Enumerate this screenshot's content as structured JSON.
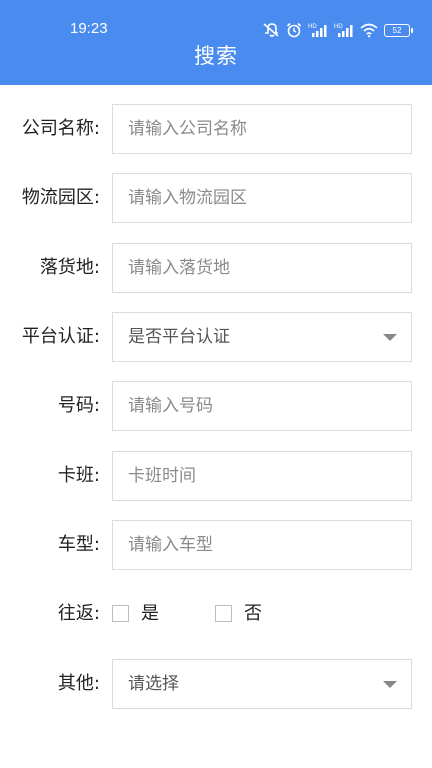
{
  "status_bar": {
    "time": "19:23",
    "icons": [
      "mute-icon",
      "alarm-icon",
      "signal-hd-icon",
      "signal-hd-icon",
      "wifi-icon"
    ],
    "battery": "52"
  },
  "header": {
    "title": "搜索"
  },
  "form": {
    "company": {
      "label": "公司名称:",
      "placeholder": "请输入公司名称"
    },
    "park": {
      "label": "物流园区:",
      "placeholder": "请输入物流园区"
    },
    "destination": {
      "label": "落货地:",
      "placeholder": "请输入落货地"
    },
    "certified": {
      "label": "平台认证:",
      "value": "是否平台认证"
    },
    "number": {
      "label": "号码:",
      "placeholder": "请输入号码"
    },
    "shift": {
      "label": "卡班:",
      "placeholder": "卡班时间"
    },
    "vehicle": {
      "label": "车型:",
      "placeholder": "请输入车型"
    },
    "roundtrip": {
      "label": "往返:",
      "yes": "是",
      "no": "否"
    },
    "other": {
      "label": "其他:",
      "value": "请选择"
    }
  }
}
